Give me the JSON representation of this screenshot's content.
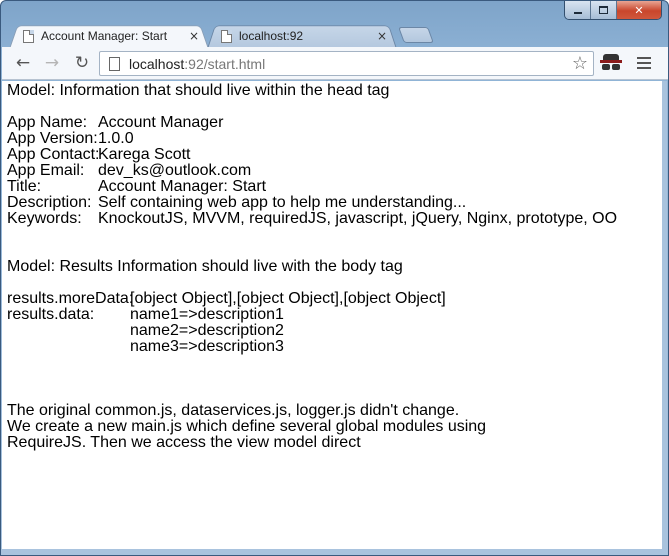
{
  "window": {
    "minimize_label": "",
    "maximize_label": "",
    "close_label": "✕"
  },
  "tabs": [
    {
      "title": "Account Manager: Start",
      "active": true,
      "close": "×"
    },
    {
      "title": "localhost:92",
      "active": false,
      "close": "×"
    }
  ],
  "toolbar": {
    "back": "←",
    "forward": "→",
    "reload": "↻",
    "url_host": "localhost",
    "url_path": ":92/start.html",
    "star": "☆",
    "incognito_icon": "incognito-icon",
    "menu_icon": "hamburger-menu-icon"
  },
  "content": {
    "model_head": "Model: Information that should live within the head tag",
    "app_info": [
      {
        "label": "App Name:",
        "value": "Account Manager"
      },
      {
        "label": "App Version:",
        "value": "1.0.0"
      },
      {
        "label": "App Contact:",
        "value": "Karega Scott"
      },
      {
        "label": "App Email:",
        "value": "dev_ks@outlook.com"
      },
      {
        "label": "Title:",
        "value": "Account Manager: Start"
      },
      {
        "label": "Description:",
        "value": "Self containing web app to help me understanding..."
      },
      {
        "label": "Keywords:",
        "value": "KnockoutJS, MVVM, requiredJS, javascript, jQuery, Nginx, prototype, OO"
      }
    ],
    "model_body": "Model: Results Information should live with the body tag",
    "more_data_label": "results.moreData:",
    "more_data_value": "[object Object],[object Object],[object Object]",
    "data_label": "results.data:",
    "data_items": [
      "name1=>description1",
      "name2=>description2",
      "name3=>description3"
    ],
    "notes": [
      "The original common.js, dataservices.js, logger.js didn't change.",
      "We create a new main.js which define several global modules using",
      "RequireJS. Then we access the view model direct"
    ]
  }
}
